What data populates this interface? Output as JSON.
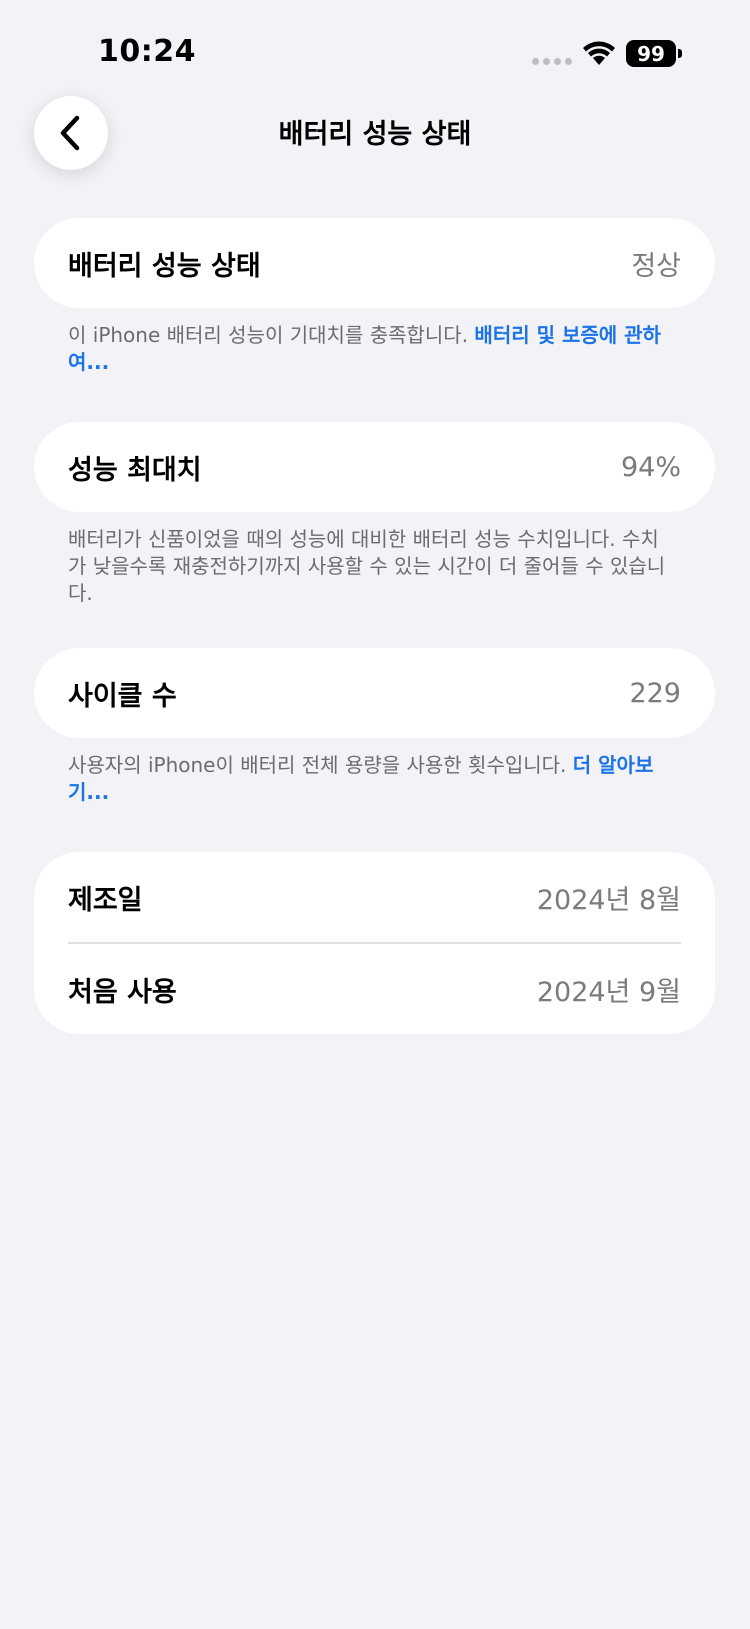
{
  "status_bar": {
    "time": "10:24",
    "battery_level": "99"
  },
  "nav": {
    "title": "배터리 성능 상태"
  },
  "health_section": {
    "label": "배터리 성능 상태",
    "value": "정상",
    "footnote": "이 iPhone 배터리 성능이 기대치를 충족합니다. ",
    "footnote_link": "배터리 및 보증에 관하여..."
  },
  "capacity_section": {
    "label": "성능 최대치",
    "value": "94%",
    "footnote": "배터리가 신품이었을 때의 성능에 대비한 배터리 성능 수치입니다. 수치가 낮을수록 재충전하기까지 사용할 수 있는 시간이 더 줄어들 수 있습니다."
  },
  "cycle_section": {
    "label": "사이클 수",
    "value": "229",
    "footnote": "사용자의 iPhone이 배터리 전체 용량을 사용한 횟수입니다. ",
    "footnote_link": "더 알아보기..."
  },
  "dates_section": {
    "manufacture_label": "제조일",
    "manufacture_value": "2024년 8월",
    "first_use_label": "처음 사용",
    "first_use_value": "2024년 9월"
  },
  "colors": {
    "background": "#f2f2f7",
    "card": "#ffffff",
    "link": "#1a73e8",
    "secondary_text": "#7a7a7f"
  }
}
